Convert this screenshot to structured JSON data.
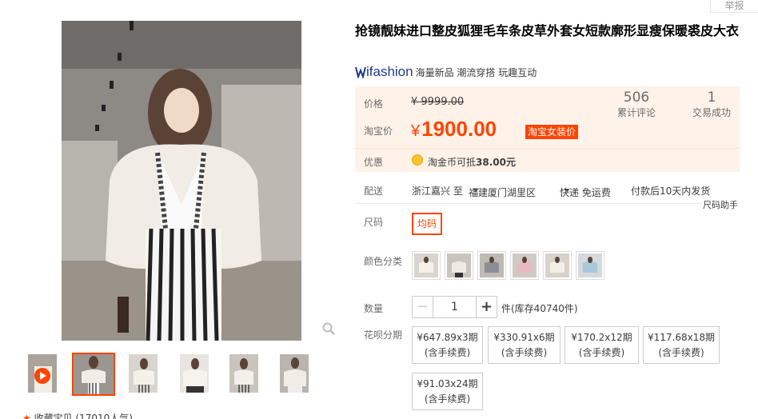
{
  "header": {
    "report_label": "举报"
  },
  "gallery": {
    "favorite_label": "收藏宝贝 (17010人气)",
    "thumbnails": [
      "video",
      "main",
      "side",
      "mirror",
      "pose",
      "coat"
    ]
  },
  "product": {
    "title": "抢镜靓妹进口整皮狐狸毛车条皮草外套女短款廓形显瘦保暖裘皮大衣",
    "brand_logo": "ifashion",
    "brand_tags": "海量新品 潮流穿搭 玩趣互动"
  },
  "price": {
    "orig_label": "价格",
    "orig_value": "¥ 9999.00",
    "cur_label": "淘宝价",
    "currency": "¥",
    "cur_value": "1900.00",
    "tag": "淘宝女装价",
    "reviews_count": "506",
    "reviews_label": "累计评论",
    "sales_count": "1",
    "sales_label": "交易成功",
    "promo_label": "优惠",
    "promo_text_pre": "淘金币可抵",
    "promo_amount": "38.00元"
  },
  "delivery": {
    "label": "配送",
    "from": "浙江嘉兴 至",
    "to": "福建厦门湖里区",
    "method": "快递 免运费",
    "ship_time": "付款后10天内发货",
    "size_helper": "尺码助手"
  },
  "size": {
    "label": "尺码",
    "option": "均码"
  },
  "color": {
    "label": "颜色分类",
    "options": [
      "c1",
      "c2",
      "c3",
      "c4",
      "c5",
      "c6"
    ]
  },
  "quantity": {
    "label": "数量",
    "value": "1",
    "minus": "−",
    "plus": "+",
    "stock": "件(库存40740件)"
  },
  "installment": {
    "label": "花呗分期",
    "fee_note": "(含手续费)",
    "plans": [
      "¥647.89x3期",
      "¥330.91x6期",
      "¥170.2x12期",
      "¥117.68x18期",
      "¥91.03x24期"
    ]
  },
  "colors": {
    "accent": "#ff4400",
    "price_bg": "#fff2e8",
    "brand": "#1e3a8a"
  }
}
